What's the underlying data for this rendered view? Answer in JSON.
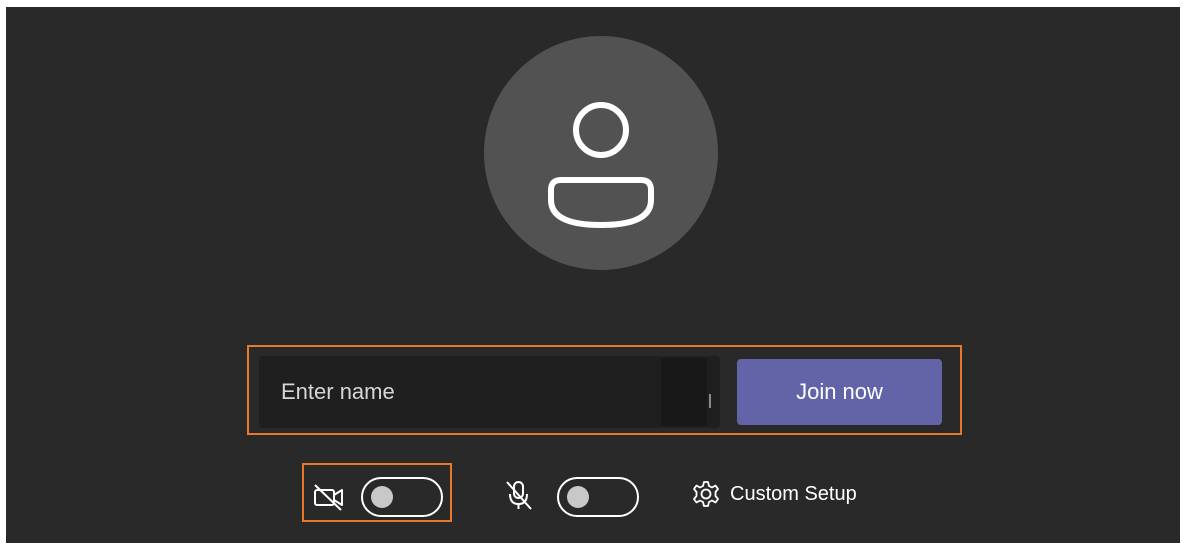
{
  "join_form": {
    "name_placeholder": "Enter name",
    "name_value": "",
    "join_label": "Join now"
  },
  "controls": {
    "camera": {
      "icon": "camera-off-icon",
      "on": false
    },
    "microphone": {
      "icon": "mic-off-icon",
      "on": false
    },
    "custom_setup": {
      "icon": "gear-icon",
      "label": "Custom Setup"
    }
  },
  "colors": {
    "background": "#292929",
    "avatar": "#525252",
    "join_button": "#6264a7",
    "highlight": "#e8782a"
  }
}
